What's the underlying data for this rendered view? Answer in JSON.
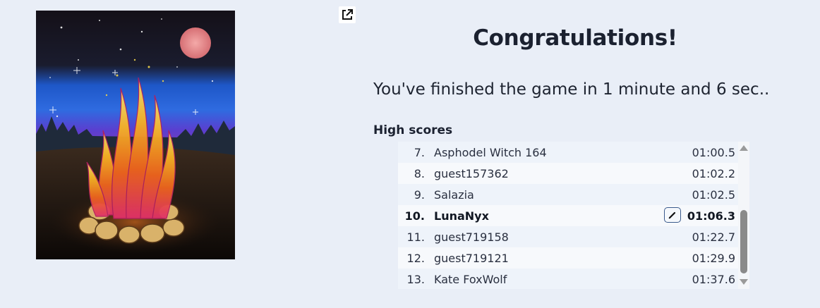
{
  "painting": {
    "alt": "Campfire under a starry night sky with a full moon"
  },
  "header": {
    "open_external_icon": "open-in-new-window-icon",
    "title": "Congratulations!",
    "message": "You've finished the game in 1 minute and 6 sec.."
  },
  "high_scores": {
    "heading": "High scores",
    "rows": [
      {
        "rank": "7.",
        "name": "Asphodel Witch 164",
        "time": "01:00.5",
        "current": false
      },
      {
        "rank": "8.",
        "name": "guest157362",
        "time": "01:02.2",
        "current": false
      },
      {
        "rank": "9.",
        "name": "Salazia",
        "time": "01:02.5",
        "current": false
      },
      {
        "rank": "10.",
        "name": "LunaNyx",
        "time": "01:06.3",
        "current": true
      },
      {
        "rank": "11.",
        "name": "guest719158",
        "time": "01:22.7",
        "current": false
      },
      {
        "rank": "12.",
        "name": "guest719121",
        "time": "01:29.9",
        "current": false
      },
      {
        "rank": "13.",
        "name": "Kate FoxWolf",
        "time": "01:37.6",
        "current": false
      }
    ],
    "edit_icon": "pencil-icon",
    "scroll_position": 0.6
  },
  "colors": {
    "background": "#e9eef7",
    "edit_border": "#3a5a8c"
  }
}
